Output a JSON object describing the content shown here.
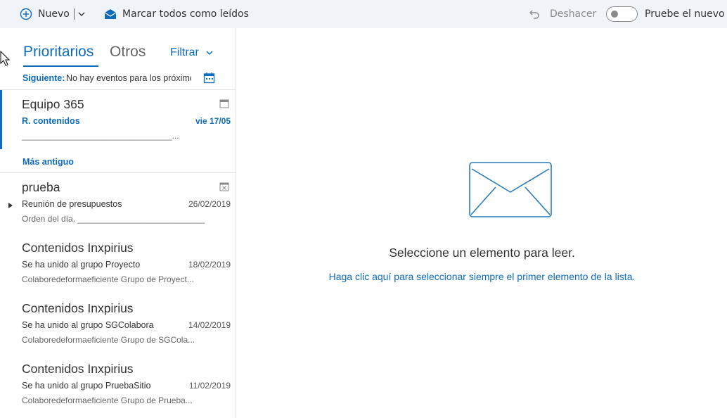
{
  "toolbar": {
    "new_label": "Nuevo",
    "mark_all_read_label": "Marcar todos como leídos",
    "undo_label": "Deshacer",
    "try_new_label": "Pruebe el nuevo Outlook"
  },
  "list": {
    "pivot_focused": "Prioritarios",
    "pivot_other": "Otros",
    "filter_label": "Filtrar",
    "next_label": "Siguiente:",
    "next_text": "No hay eventos para los próximos dos días",
    "group_older": "Más antiguo",
    "messages": [
      {
        "sender": "Equipo 365",
        "subject": "R. contenidos",
        "date": "vie 17/05",
        "preview": "________________________________..."
      },
      {
        "sender": "prueba",
        "subject": "Reunión de presupuestos",
        "date": "26/02/2019",
        "preview": "Orden del día.      ____________________________..."
      },
      {
        "sender": "Contenidos Inxpirius",
        "subject": "Se ha unido al grupo Proyecto",
        "date": "18/02/2019",
        "preview": "Colaboredeformaeficiente  Grupo de Proyect..."
      },
      {
        "sender": "Contenidos Inxpirius",
        "subject": "Se ha unido al grupo SGColabora",
        "date": "14/02/2019",
        "preview": "Colaboredeformaeficiente  Grupo de SGCola..."
      },
      {
        "sender": "Contenidos Inxpirius",
        "subject": "Se ha unido al grupo PruebaSitio",
        "date": "11/02/2019",
        "preview": "Colaboredeformaeficiente  Grupo de Prueba..."
      }
    ]
  },
  "reading": {
    "empty_title": "Seleccione un elemento para leer.",
    "empty_link": "Haga clic aquí para seleccionar siempre el primer elemento de la lista."
  },
  "colors": {
    "accent": "#0f6cbd",
    "toolbar_bg": "#f0f4f8",
    "divider": "#e1e1e1"
  }
}
